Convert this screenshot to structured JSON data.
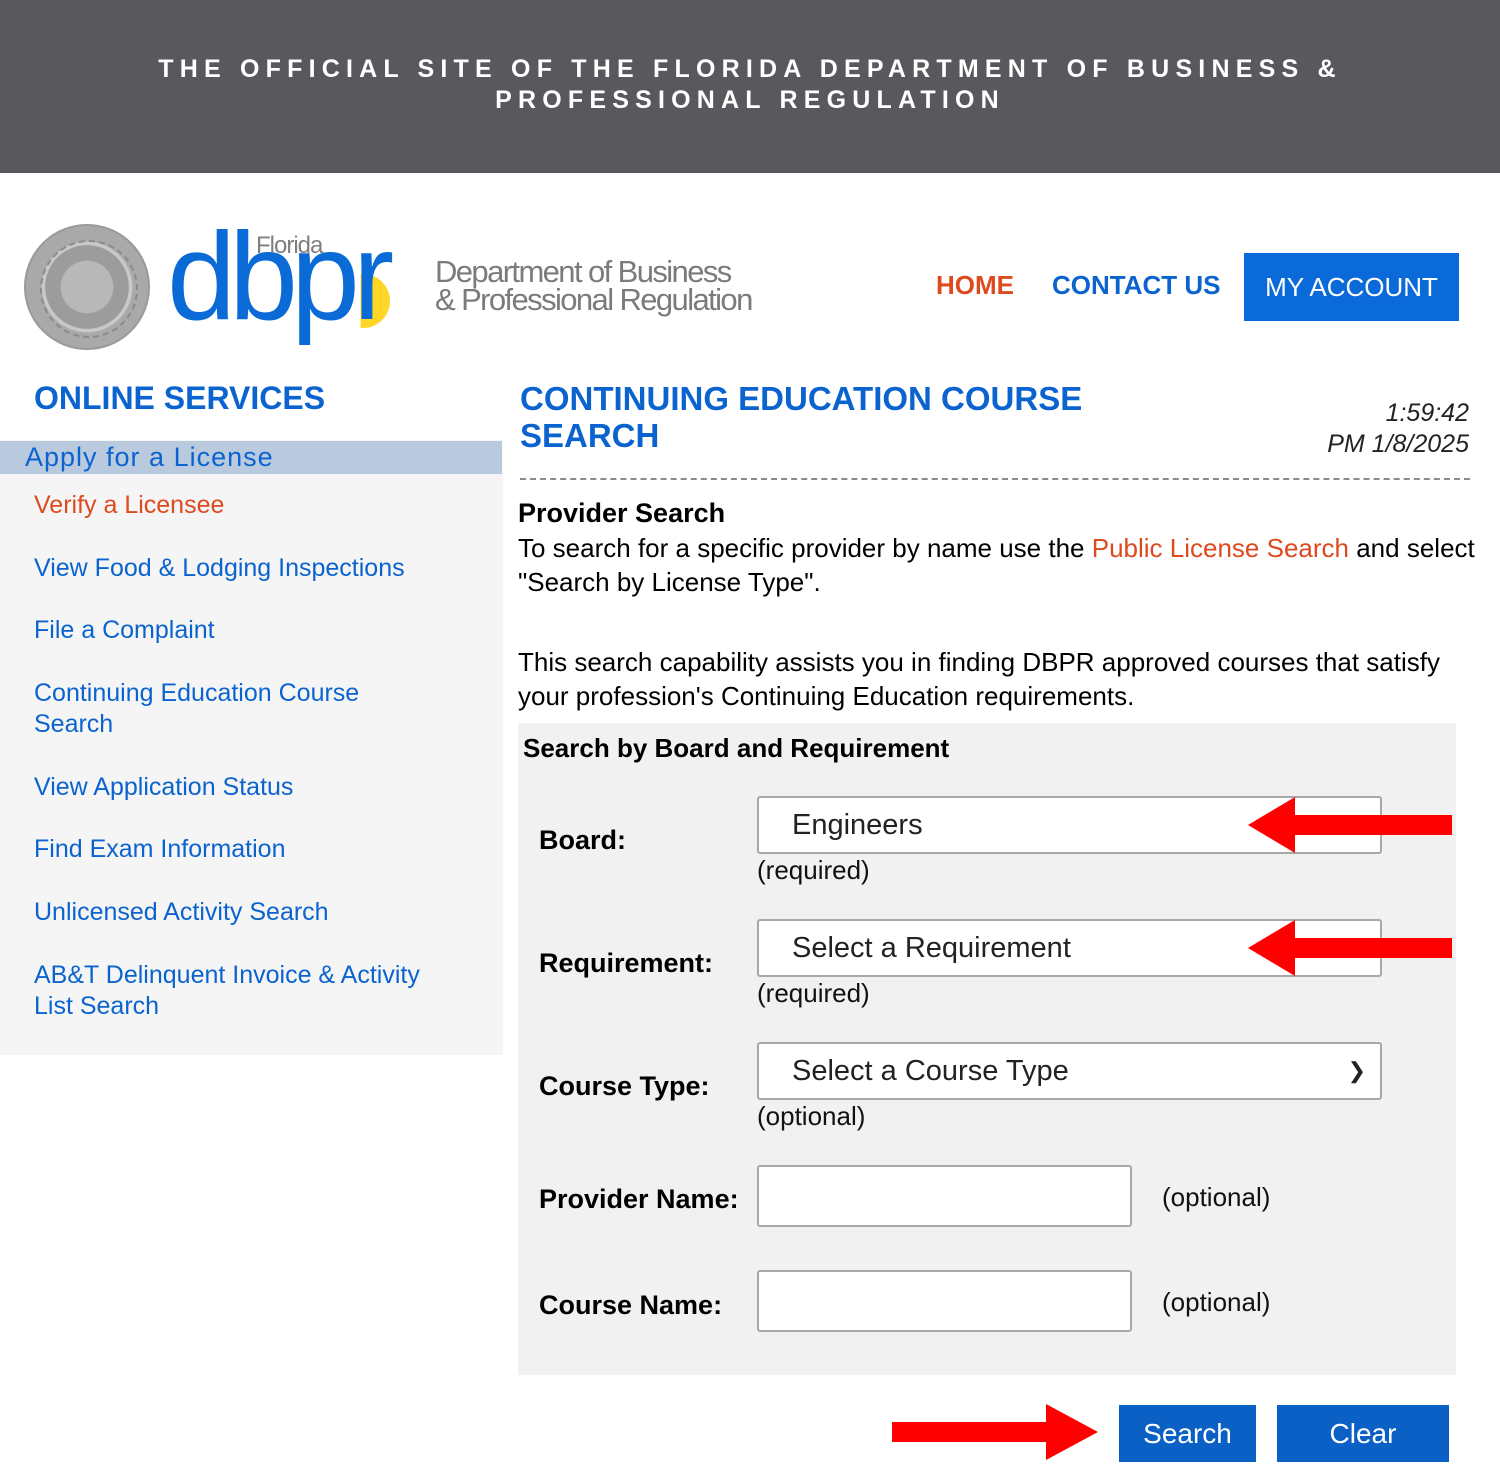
{
  "banner": {
    "line1": "THE OFFICIAL SITE OF THE FLORIDA DEPARTMENT OF BUSINESS &",
    "line2": "PROFESSIONAL REGULATION"
  },
  "logo": {
    "florida": "Florida",
    "dbpr": "dbpr",
    "dept_line1": "Department of Business",
    "dept_line2": "& Professional Regulation"
  },
  "nav": {
    "home": "HOME",
    "contact": "CONTACT US",
    "account": "MY ACCOUNT"
  },
  "sidebar": {
    "title": "ONLINE SERVICES",
    "active": "Apply for a License",
    "items": [
      {
        "label": "Verify a Licensee"
      },
      {
        "label": "View Food & Lodging Inspections"
      },
      {
        "label": "File a Complaint"
      },
      {
        "label": "Continuing Education Course Search"
      },
      {
        "label": "View Application Status"
      },
      {
        "label": "Find Exam Information"
      },
      {
        "label": "Unlicensed Activity Search"
      },
      {
        "label": "AB&T Delinquent Invoice & Activity List Search"
      }
    ]
  },
  "main": {
    "title_line1": "CONTINUING EDUCATION COURSE",
    "title_line2": "SEARCH",
    "time": "1:59:42",
    "date": "PM 1/8/2025",
    "provider_heading": "Provider Search",
    "provider_text_before": "To search for a specific provider by name use the ",
    "provider_link": "Public License Search",
    "provider_text_after": " and select \"Search by License Type\".",
    "description": "This search capability assists you in finding DBPR approved courses that satisfy your profession's Continuing Education requirements."
  },
  "form": {
    "title": "Search by Board and Requirement",
    "board": {
      "label": "Board:",
      "value": "Engineers",
      "hint": "(required)"
    },
    "requirement": {
      "label": "Requirement:",
      "value": "Select a Requirement",
      "hint": "(required)"
    },
    "course_type": {
      "label": "Course Type:",
      "value": "Select a Course Type",
      "hint": "(optional)"
    },
    "provider_name": {
      "label": "Provider Name:",
      "value": "",
      "hint": "(optional)"
    },
    "course_name": {
      "label": "Course Name:",
      "value": "",
      "hint": "(optional)"
    }
  },
  "buttons": {
    "search": "Search",
    "clear": "Clear"
  },
  "colors": {
    "brand_blue": "#0a63cf",
    "accent_red": "#dd4a1e",
    "annotation_arrow": "#ff0000"
  }
}
